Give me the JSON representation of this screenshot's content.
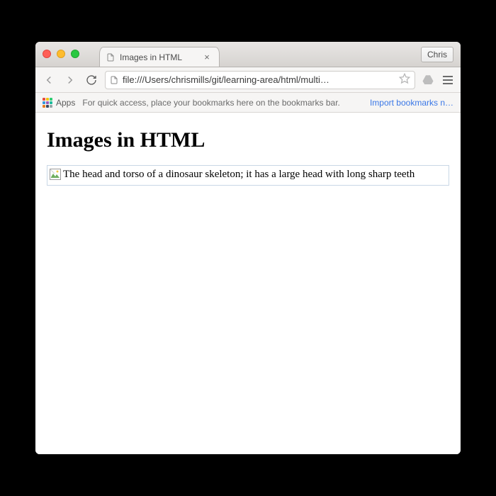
{
  "window": {
    "profile_name": "Chris"
  },
  "tab": {
    "title": "Images in HTML"
  },
  "toolbar": {
    "url": "file:///Users/chrismills/git/learning-area/html/multi…"
  },
  "bookmarks": {
    "apps_label": "Apps",
    "hint_text": "For quick access, place your bookmarks here on the bookmarks bar.",
    "import_link": "Import bookmarks n…"
  },
  "page": {
    "heading": "Images in HTML",
    "alt_text": "The head and torso of a dinosaur skeleton; it has a large head with long sharp teeth"
  },
  "apps_colors": [
    "#e74c3c",
    "#f1c40f",
    "#2ecc71",
    "#3498db",
    "#9b59b6",
    "#1abc9c",
    "#e67e22",
    "#34495e",
    "#95a5a6"
  ]
}
